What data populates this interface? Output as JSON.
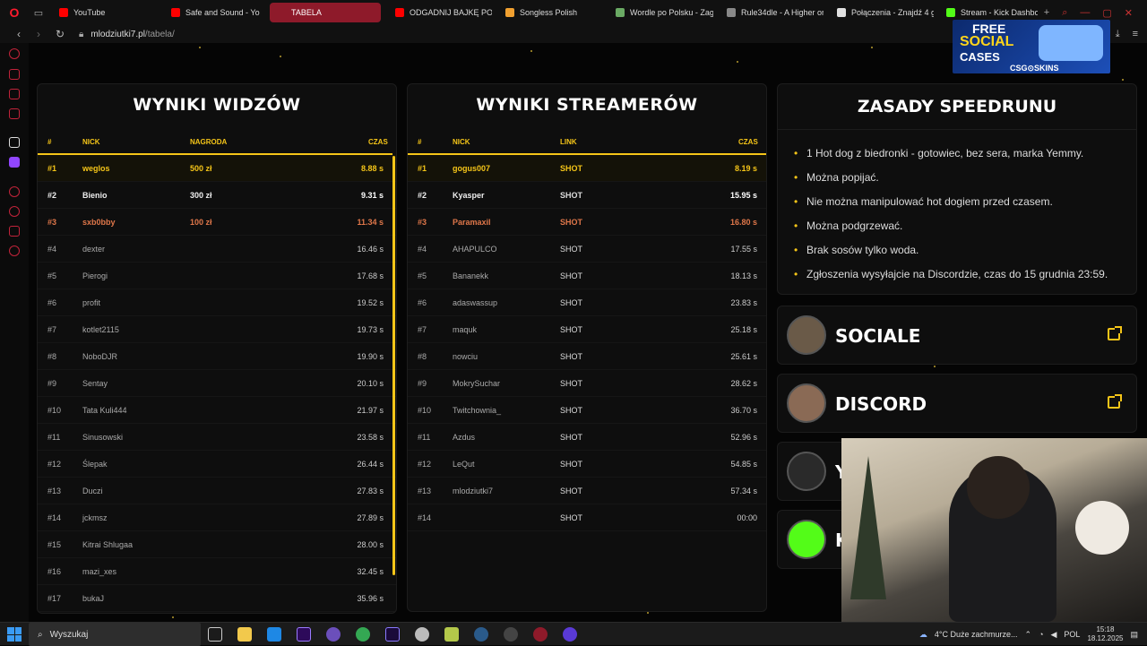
{
  "browser": {
    "tabs": [
      {
        "label": "YouTube",
        "color": "#ff0000"
      },
      {
        "label": "Safe and Sound - Yo",
        "color": "#ff0000"
      },
      {
        "label": "TABELA",
        "color": "#8e1a2a"
      },
      {
        "label": "ODGADNIJ BAJKĘ PO P",
        "color": "#ff0000"
      },
      {
        "label": "Songless Polish",
        "color": "#f0a030"
      },
      {
        "label": "Wordle po Polsku - Zagr",
        "color": "#6aaa64"
      },
      {
        "label": "Rule34dle - A Higher or",
        "color": "#888888"
      },
      {
        "label": "Połączenia - Znajdź 4 g",
        "color": "#e0e0e0"
      },
      {
        "label": "Stream - Kick Dashboar",
        "color": "#53fc18"
      }
    ],
    "new_tab_icon": "plus-icon",
    "url_domain": "mlodziutki7.pl",
    "url_path": "/tabela/"
  },
  "ad": {
    "line1": "FREE",
    "line2": "SOCIAL",
    "line3": "CASES",
    "brand": "CSG⊙SKINS"
  },
  "viewers": {
    "title": "WYNIKI WIDZÓW",
    "headers": {
      "rank": "#",
      "nick": "NICK",
      "prize": "NAGRODA",
      "time": "CZAS"
    },
    "rows": [
      {
        "rank": "#1",
        "nick": "weglos",
        "prize": "500 zł",
        "time": "8.88 s",
        "tier": "gold"
      },
      {
        "rank": "#2",
        "nick": "Bienio",
        "prize": "300 zł",
        "time": "9.31 s",
        "tier": "silver"
      },
      {
        "rank": "#3",
        "nick": "sxb0bby",
        "prize": "100 zł",
        "time": "11.34 s",
        "tier": "bronze"
      },
      {
        "rank": "#4",
        "nick": "dexter",
        "prize": "",
        "time": "16.46 s",
        "tier": "norm"
      },
      {
        "rank": "#5",
        "nick": "Pierogi",
        "prize": "",
        "time": "17.68 s",
        "tier": "norm"
      },
      {
        "rank": "#6",
        "nick": "profit",
        "prize": "",
        "time": "19.52 s",
        "tier": "norm"
      },
      {
        "rank": "#7",
        "nick": "kotlet2115",
        "prize": "",
        "time": "19.73 s",
        "tier": "norm"
      },
      {
        "rank": "#8",
        "nick": "NoboDJR",
        "prize": "",
        "time": "19.90 s",
        "tier": "norm"
      },
      {
        "rank": "#9",
        "nick": "Sentay",
        "prize": "",
        "time": "20.10 s",
        "tier": "norm"
      },
      {
        "rank": "#10",
        "nick": "Tata Kuli444",
        "prize": "",
        "time": "21.97 s",
        "tier": "norm"
      },
      {
        "rank": "#11",
        "nick": "Sinusowski",
        "prize": "",
        "time": "23.58 s",
        "tier": "norm"
      },
      {
        "rank": "#12",
        "nick": "Ślepak",
        "prize": "",
        "time": "26.44 s",
        "tier": "norm"
      },
      {
        "rank": "#13",
        "nick": "Duczi",
        "prize": "",
        "time": "27.83 s",
        "tier": "norm"
      },
      {
        "rank": "#14",
        "nick": "jckmsz",
        "prize": "",
        "time": "27.89 s",
        "tier": "norm"
      },
      {
        "rank": "#15",
        "nick": "Kitrai Shlugaa",
        "prize": "",
        "time": "28.00 s",
        "tier": "norm"
      },
      {
        "rank": "#16",
        "nick": "mazi_xes",
        "prize": "",
        "time": "32.45 s",
        "tier": "norm"
      },
      {
        "rank": "#17",
        "nick": "bukaJ",
        "prize": "",
        "time": "35.96 s",
        "tier": "norm"
      }
    ]
  },
  "streamers": {
    "title": "WYNIKI STREAMERÓW",
    "headers": {
      "rank": "#",
      "nick": "NICK",
      "link": "LINK",
      "time": "CZAS"
    },
    "rows": [
      {
        "rank": "#1",
        "nick": "gogus007",
        "link": "SHOT",
        "time": "8.19 s",
        "tier": "gold"
      },
      {
        "rank": "#2",
        "nick": "Kyasper",
        "link": "SHOT",
        "time": "15.95 s",
        "tier": "silver"
      },
      {
        "rank": "#3",
        "nick": "Paramaxil",
        "link": "SHOT",
        "time": "16.80 s",
        "tier": "bronze"
      },
      {
        "rank": "#4",
        "nick": "AHAPULCO",
        "link": "SHOT",
        "time": "17.55 s",
        "tier": "norm"
      },
      {
        "rank": "#5",
        "nick": "Bananekk",
        "link": "SHOT",
        "time": "18.13 s",
        "tier": "norm"
      },
      {
        "rank": "#6",
        "nick": "adaswassup",
        "link": "SHOT",
        "time": "23.83 s",
        "tier": "norm"
      },
      {
        "rank": "#7",
        "nick": "maquk",
        "link": "SHOT",
        "time": "25.18 s",
        "tier": "norm"
      },
      {
        "rank": "#8",
        "nick": "nowciu",
        "link": "SHOT",
        "time": "25.61 s",
        "tier": "norm"
      },
      {
        "rank": "#9",
        "nick": "MokrySuchar",
        "link": "SHOT",
        "time": "28.62 s",
        "tier": "norm"
      },
      {
        "rank": "#10",
        "nick": "Twitchownia_",
        "link": "SHOT",
        "time": "36.70 s",
        "tier": "norm"
      },
      {
        "rank": "#11",
        "nick": "Azdus",
        "link": "SHOT",
        "time": "52.96 s",
        "tier": "norm"
      },
      {
        "rank": "#12",
        "nick": "LeQut",
        "link": "SHOT",
        "time": "54.85 s",
        "tier": "norm"
      },
      {
        "rank": "#13",
        "nick": "mlodziutki7",
        "link": "SHOT",
        "time": "57.34 s",
        "tier": "norm"
      },
      {
        "rank": "#14",
        "nick": "",
        "link": "SHOT",
        "time": "00:00",
        "tier": "norm"
      }
    ]
  },
  "rules": {
    "title": "ZASADY SPEEDRUNU",
    "items": [
      "1 Hot dog z biedronki - gotowiec, bez sera, marka Yemmy.",
      "Można popijać.",
      "Nie można manipulować hot dogiem przed czasem.",
      "Można podgrzewać.",
      "Brak sosów tylko woda.",
      "Zgłoszenia wysyłajcie na Discordzie, czas do 15 grudnia 23:59."
    ]
  },
  "cards": [
    {
      "label": "SOCIALE",
      "avatar_color": "#6a5a48"
    },
    {
      "label": "DISCORD",
      "avatar_color": "#8a6a55"
    },
    {
      "label": "Y",
      "avatar_color": "#2a2a2a"
    },
    {
      "label": "K",
      "avatar_color": "#53fc18"
    }
  ],
  "taskbar": {
    "search_placeholder": "Wyszukaj",
    "weather": "4°C  Duże zachmurze...",
    "lang": "POL",
    "time": "15:18",
    "date": "18.12.2025"
  },
  "colors": {
    "accent": "#f5c518",
    "bronze": "#e0774a",
    "brand_red": "#c2233a"
  }
}
